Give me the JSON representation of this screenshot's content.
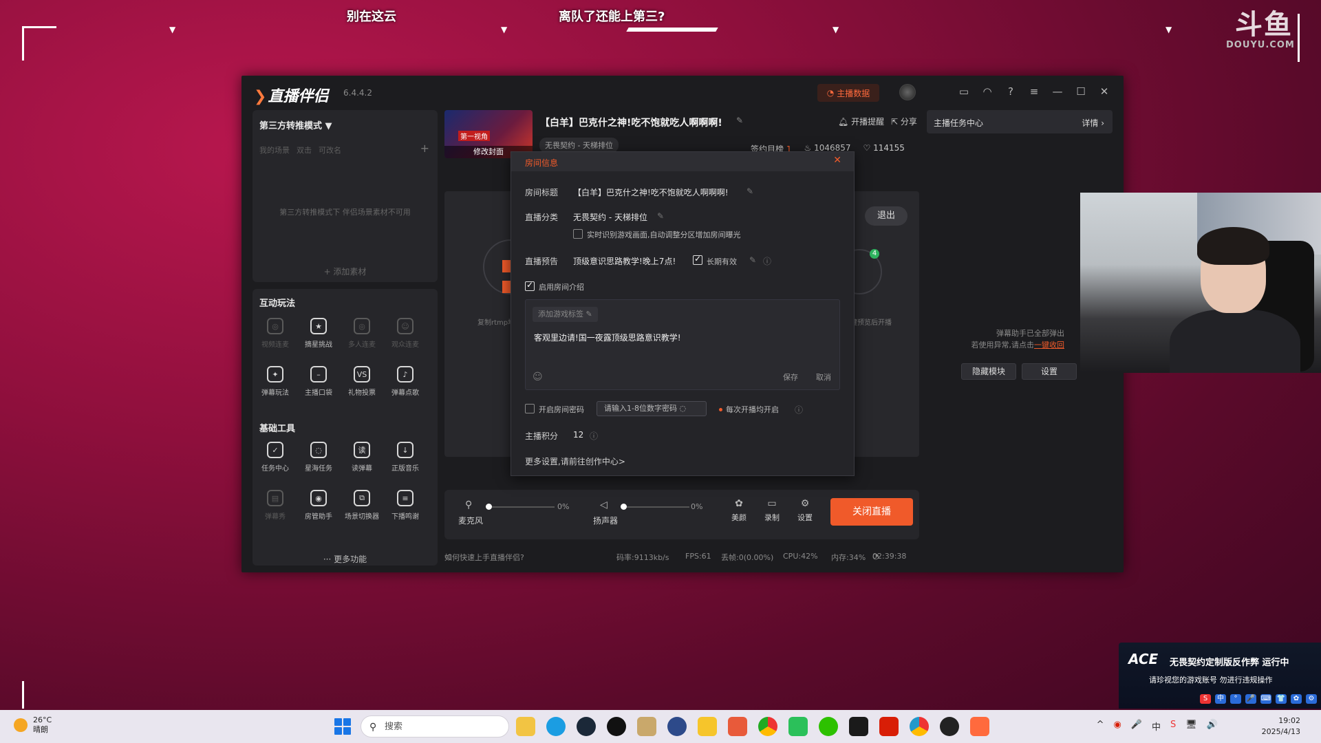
{
  "overlay": {
    "banner_left": "别在这云",
    "banner_right": "离队了还能上第三?",
    "douyu_big": "斗鱼",
    "douyu_small": "DOUYU.COM"
  },
  "app": {
    "logo": "直播伴侣",
    "version": "6.4.4.2",
    "data_button": "主播数据",
    "window_icons": [
      "chat-icon",
      "headset-icon",
      "help-icon",
      "menu-icon",
      "minimize-icon",
      "maximize-icon",
      "close-icon"
    ]
  },
  "left": {
    "mode": "第三方转推模式 ▼",
    "scene_tabs": [
      "我的场景",
      "双击",
      "可改名"
    ],
    "na_text": "第三方转推模式下 伴侣场景素材不可用",
    "add_material": "+ 添加素材",
    "interactive_title": "互动玩法",
    "interactive": [
      {
        "label": "视频连麦",
        "dim": true
      },
      {
        "label": "摘星挑战",
        "dim": false
      },
      {
        "label": "多人连麦",
        "dim": true
      },
      {
        "label": "观众连麦",
        "dim": true
      },
      {
        "label": "弹幕玩法",
        "dim": false
      },
      {
        "label": "主播口袋",
        "dim": false
      },
      {
        "label": "礼物投票",
        "dim": false
      },
      {
        "label": "弹幕点歌",
        "dim": false
      }
    ],
    "basic_title": "基础工具",
    "basic": [
      {
        "label": "任务中心",
        "dim": false
      },
      {
        "label": "星海任务",
        "dim": false
      },
      {
        "label": "读弹幕",
        "dim": false
      },
      {
        "label": "正版音乐",
        "dim": false
      },
      {
        "label": "弹幕秀",
        "dim": true
      },
      {
        "label": "房管助手",
        "dim": false
      },
      {
        "label": "场景切换器",
        "dim": false
      },
      {
        "label": "下播鸣谢",
        "dim": false
      }
    ],
    "more": "··· 更多功能"
  },
  "header": {
    "cover_edit": "修改封面",
    "cover_tag": "第一视角",
    "room_title": "【白羊】巴克什之神!吃不饱就吃人啊啊啊!",
    "remind": "开播提醒",
    "share": "分享",
    "category_pill": "无畏契约 - 天梯排位",
    "sign_rank": "签约目榜",
    "sign_rank_num": "1",
    "hot": "1046857",
    "likes": "114155"
  },
  "preview": {
    "exit": "退出",
    "left_caption": "复制rtmp地址",
    "right_caption": "一键预览后开播",
    "badge": "4"
  },
  "controls": {
    "mic_label": "麦克风",
    "mic_pct": "0%",
    "speaker_label": "扬声器",
    "speaker_pct": "0%",
    "beauty": "美颜",
    "record": "录制",
    "settings": "设置",
    "close_live": "关闭直播"
  },
  "status": {
    "help": "如何快速上手直播伴侣?",
    "bitrate": "码率:9113kb/s",
    "fps": "FPS:61",
    "drop": "丢帧:0(0.00%)",
    "cpu": "CPU:42%",
    "mem": "内存:34%",
    "time": "02:39:38"
  },
  "right": {
    "task_center": "主播任务中心",
    "details": "详情 ›",
    "msg1": "弹幕助手已全部弹出",
    "msg2": "若使用异常,请点击",
    "msg_link": "一键收回",
    "hide_module": "隐藏模块",
    "settings": "设置"
  },
  "modal": {
    "title": "房间信息",
    "room_title_label": "房间标题",
    "room_title_value": "【白羊】巴克什之神!吃不饱就吃人啊啊啊!",
    "category_label": "直播分类",
    "category_value": "无畏契约 - 天梯排位",
    "auto_detect": "实时识别游戏画面,自动调整分区增加房间曝光",
    "preview_label": "直播预告",
    "preview_value": "顶级意识思路教学!晚上7点!",
    "long_valid": "长期有效",
    "enable_intro": "启用房间介绍",
    "add_tag": "添加游戏标签",
    "intro_text": "客观里边请!国一夜露顶级思路意识教学!",
    "save": "保存",
    "cancel": "取消",
    "pwd_enable": "开启房间密码",
    "pwd_placeholder": "请输入1-8位数字密码",
    "pwd_each": "每次开播均开启",
    "points_label": "主播积分",
    "points_value": "12",
    "more_settings": "更多设置,请前往创作中心>"
  },
  "ace": {
    "logo": "ACE",
    "line1": "无畏契约定制版反作弊 运行中",
    "line2": "请珍视您的游戏账号 勿进行违规操作",
    "ime": [
      "S",
      "中",
      "°",
      "🎤",
      "⌨",
      "👕",
      "✿",
      "⚙"
    ]
  },
  "taskbar": {
    "temp": "26°C",
    "weather": "晴朗",
    "search": "搜索",
    "tray": [
      "^",
      "◉",
      "🎤",
      "中",
      "S",
      "🖥",
      "🔊"
    ],
    "time": "19:02",
    "date": "2025/4/13"
  }
}
